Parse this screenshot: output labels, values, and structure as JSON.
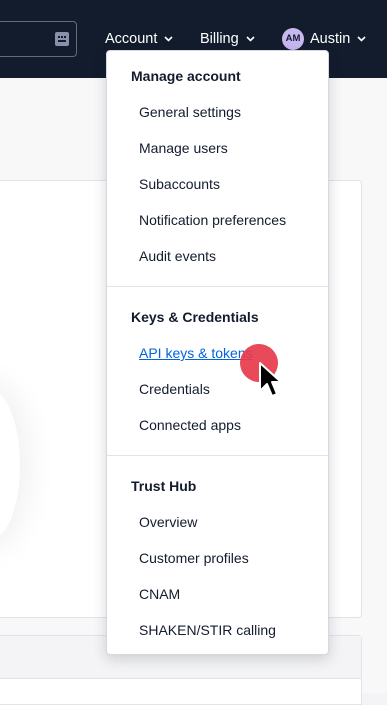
{
  "topbar": {
    "nav": {
      "account_label": "Account",
      "billing_label": "Billing",
      "user_initials": "AM",
      "user_name": "Austin"
    }
  },
  "account_menu": {
    "sections": [
      {
        "title": "Manage account",
        "items": [
          "General settings",
          "Manage users",
          "Subaccounts",
          "Notification preferences",
          "Audit events"
        ]
      },
      {
        "title": "Keys & Credentials",
        "items": [
          "API keys & tokens",
          "Credentials",
          "Connected apps"
        ]
      },
      {
        "title": "Trust Hub",
        "items": [
          "Overview",
          "Customer profiles",
          "CNAM",
          "SHAKEN/STIR calling"
        ]
      }
    ]
  },
  "colors": {
    "topbar_bg": "#121c2d",
    "link_active": "#0263e0",
    "avatar_bg": "#c8b8f0",
    "click_indicator": "#e63b4b"
  },
  "icons": [
    "keyboard-shortcut-icon",
    "chevron-down-icon",
    "mouse-pointer-icon"
  ]
}
